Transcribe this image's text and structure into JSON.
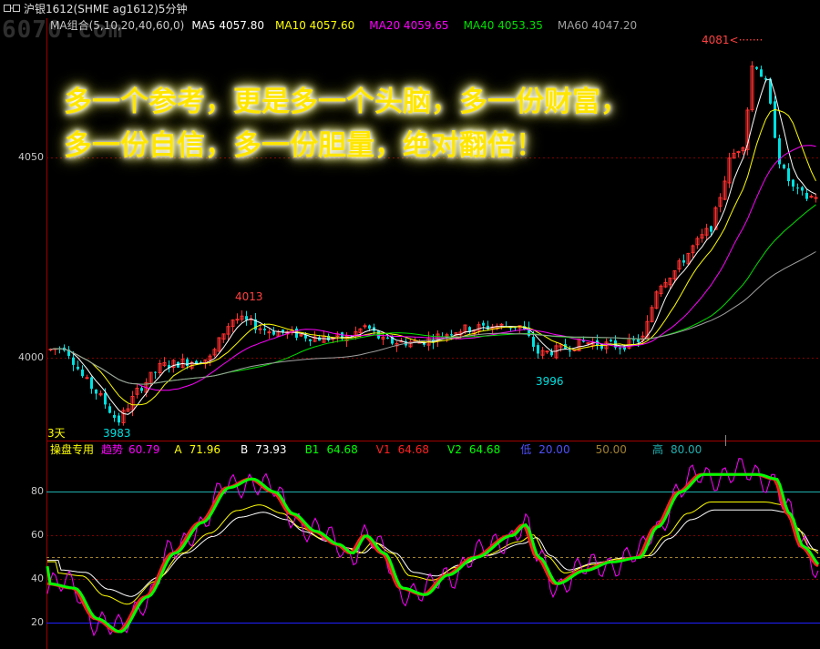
{
  "window": {
    "title": "沪银1612(SHME ag1612)5分钟"
  },
  "watermark": "6070.com",
  "price_panel": {
    "legend": [
      {
        "label": "MA组合(5,10,20,40,60,0)",
        "color": "#c8c8c8"
      },
      {
        "label": "MA5 4057.80",
        "color": "#ffffff"
      },
      {
        "label": "MA10 4057.60",
        "color": "#ffff00"
      },
      {
        "label": "MA20 4059.65",
        "color": "#ff00ff"
      },
      {
        "label": "MA40 4053.35",
        "color": "#00e000"
      },
      {
        "label": "MA60 4047.20",
        "color": "#a0a0a0"
      }
    ],
    "y_ticks": [
      "4050",
      "4000"
    ],
    "annotations": {
      "high_right": "4081",
      "high_left": "4013",
      "low_mid": "3996",
      "low_left": "3983"
    },
    "days_label": "3天",
    "promo_lines": [
      "多一个参考，更是多一个头脑，多一份财富，",
      "多一份自信，多一份胆量，绝对翻倍！"
    ]
  },
  "indicator_panel": {
    "legend": [
      {
        "label": "操盘专用",
        "color": "#ffff00"
      },
      {
        "label": "趋势",
        "color": "#ff00ff"
      },
      {
        "label": "60.79",
        "color": "#ff00ff"
      },
      {
        "label": "A",
        "color": "#ffff00"
      },
      {
        "label": "71.96",
        "color": "#ffff00"
      },
      {
        "label": "B",
        "color": "#ffffff"
      },
      {
        "label": "73.93",
        "color": "#ffffff"
      },
      {
        "label": "B1",
        "color": "#00ff00"
      },
      {
        "label": "64.68",
        "color": "#00ff00"
      },
      {
        "label": "V1",
        "color": "#ff2020"
      },
      {
        "label": "64.68",
        "color": "#ff2020"
      },
      {
        "label": "V2",
        "color": "#00ff00"
      },
      {
        "label": "64.68",
        "color": "#00ff00"
      },
      {
        "label": "低",
        "color": "#5050ff"
      },
      {
        "label": "20.00",
        "color": "#5050ff"
      },
      {
        "label": "50.00",
        "color": "#a08030"
      },
      {
        "label": "高",
        "color": "#20b0b0"
      },
      {
        "label": "80.00",
        "color": "#20b0b0"
      }
    ],
    "y_ticks": [
      "80",
      "60",
      "40",
      "20"
    ]
  },
  "colors": {
    "up": "#ff3030",
    "down": "#00e0e0",
    "grid": "#800000",
    "axis": "#a00000"
  }
}
